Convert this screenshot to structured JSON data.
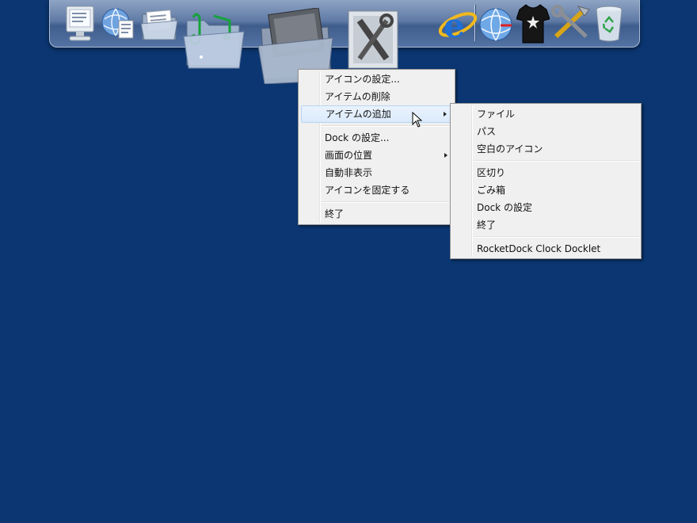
{
  "context_menu": {
    "items": [
      {
        "label": "アイコンの設定..."
      },
      {
        "label": "アイテムの削除"
      },
      {
        "label": "アイテムの追加"
      },
      {
        "label": "Dock の設定..."
      },
      {
        "label": "画面の位置"
      },
      {
        "label": "自動非表示"
      },
      {
        "label": "アイコンを固定する"
      },
      {
        "label": "終了"
      }
    ]
  },
  "submenu": {
    "items": [
      {
        "label": "ファイル"
      },
      {
        "label": "パス"
      },
      {
        "label": "空白のアイコン"
      },
      {
        "label": "区切り"
      },
      {
        "label": "ごみ箱"
      },
      {
        "label": "Dock の設定"
      },
      {
        "label": "終了"
      },
      {
        "label": "RocketDock Clock Docklet"
      }
    ]
  },
  "colors": {
    "desktop": "#0b3671",
    "menu_bg": "#f0f0f0",
    "highlight": "#dbeafc"
  },
  "dock": {
    "icons": [
      "computer-icon",
      "network-globe-icon",
      "documents-folder-icon",
      "music-folder-icon",
      "pictures-folder-icon",
      "tools-folder-icon",
      "internet-explorer-icon",
      "globe-icon",
      "tshirt-icon",
      "tools-icon",
      "recycle-bin-icon"
    ]
  }
}
